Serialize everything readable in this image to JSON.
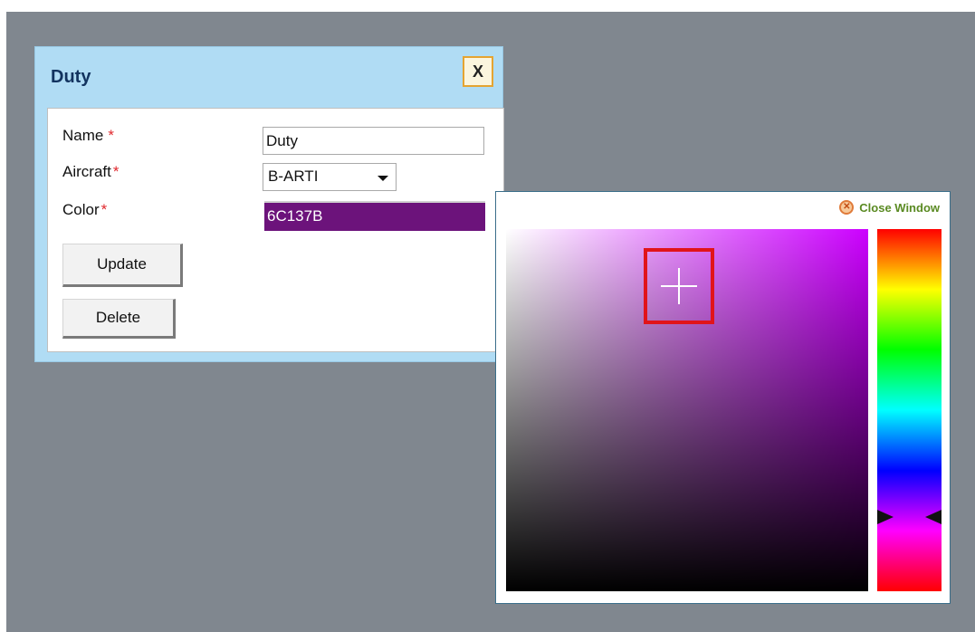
{
  "dialog": {
    "title": "Duty",
    "close_label": "X",
    "fields": {
      "name_label": "Name",
      "name_value": "Duty",
      "aircraft_label": "Aircraft",
      "aircraft_value": "B-ARTI",
      "color_label": "Color",
      "color_value": "6C137B",
      "required_marker": "*"
    },
    "buttons": {
      "update": "Update",
      "delete": "Delete"
    }
  },
  "color_picker": {
    "close_window_label": "Close Window",
    "close_window_icon": "close-circle-icon",
    "hue_color": "#cc00ff",
    "selected_color": "#6c137b"
  },
  "colors": {
    "backdrop": "#80878f",
    "dialog_frame": "#b0dcf4",
    "title_text": "#12335f",
    "required_marker": "#e0282d",
    "selection_marker": "#e1141a"
  }
}
